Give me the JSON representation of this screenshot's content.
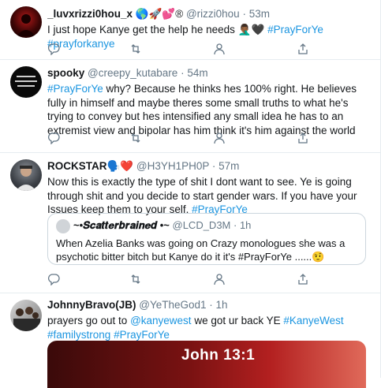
{
  "tweets": [
    {
      "name": "_luvxrizzi0hou_x",
      "name_suffix": "🌎🚀💕®",
      "handle": "@rizzi0hou",
      "time": "53m",
      "text_plain": "I just hope Kanye get the help he needs 🤦🏾‍♂️🖤 ",
      "tags": [
        "#PrayForYe",
        "#prayforkanye"
      ]
    },
    {
      "name": "spooky",
      "handle": "@creepy_kutabare",
      "time": "54m",
      "tag_lead": "#PrayForYe",
      "text": " why? Because he thinks hes 100% right. He believes fully in himself and maybe theres some small truths to what he's trying to convey but hes intensified any small idea he has to an extremist view and bipolar has him think it's him against the world"
    },
    {
      "name": "ROCKSTAR",
      "name_suffix": "🗣️❤️",
      "handle": "@H3YH1PH0P",
      "time": "57m",
      "text": "Now this is exactly the type of shit I dont want to see. Ye is going through shit and you decide to start gender wars. If you have your Issues keep them to your self. ",
      "tag_tail": "#PrayForYe",
      "quote": {
        "name": "~•𝑺𝒄𝒂𝒕𝒕𝒆𝒓𝒃𝒓𝒂𝒊𝒏𝒆𝒅 •~",
        "handle": "@LCD_D3M",
        "time": "1h",
        "text": "When Azelia Banks was going on Crazy monologues she was a psychotic bitter bitch but Kanye do it it's #PrayForYe ......🤨"
      }
    },
    {
      "name": "JohnnyBravo(JB)",
      "handle": "@YeTheGod1",
      "time": "1h",
      "text_pre": "prayers go out to ",
      "mention": "@kanyewest",
      "text_mid": " we got ur back YE ",
      "tags": [
        "#KanyeWest",
        "#familystrong",
        "#PrayForYe"
      ],
      "media_caption": "John 13:1"
    }
  ],
  "separator": " · ",
  "colors": {
    "link": "#1b95e0",
    "muted": "#657786",
    "border": "#e6ecf0"
  },
  "icons": [
    "reply-icon",
    "retweet-icon",
    "like-icon",
    "share-icon"
  ]
}
